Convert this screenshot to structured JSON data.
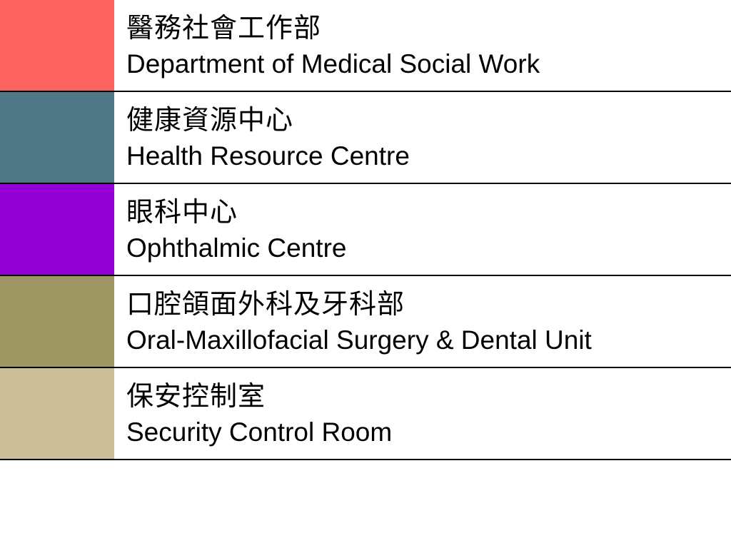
{
  "departments": [
    {
      "name_zh": "醫務社會工作部",
      "name_en": "Department of Medical Social Work",
      "color": "#fd6461"
    },
    {
      "name_zh": "健康資源中心",
      "name_en": "Health Resource Centre",
      "color": "#4f7786"
    },
    {
      "name_zh": "眼科中心",
      "name_en": "Ophthalmic Centre",
      "color": "#9200d6"
    },
    {
      "name_zh": "口腔頜面外科及牙科部",
      "name_en": "Oral-Maxillofacial Surgery & Dental Unit",
      "color": "#9c9762"
    },
    {
      "name_zh": "保安控制室",
      "name_en": "Security Control Room",
      "color": "#cbbd97"
    }
  ]
}
